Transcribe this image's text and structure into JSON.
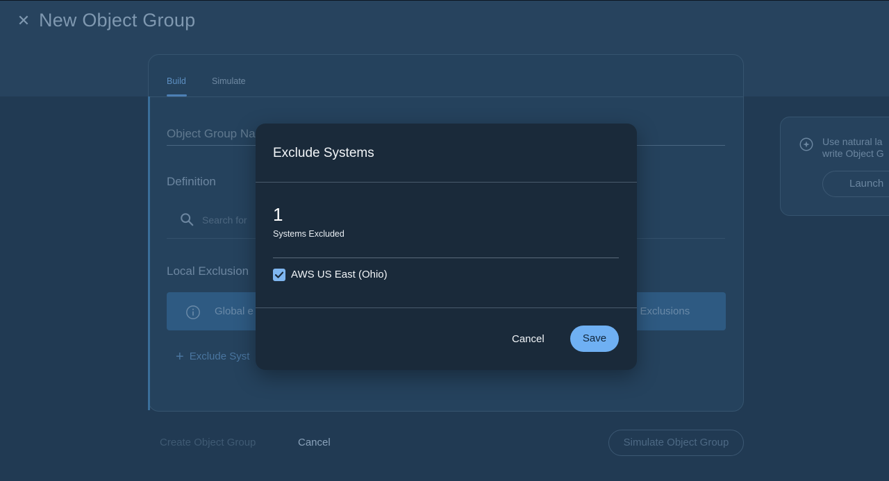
{
  "header": {
    "close_icon": "close-icon",
    "title": "New Object Group"
  },
  "tabs": [
    {
      "label": "Build",
      "active": true
    },
    {
      "label": "Simulate",
      "active": false
    }
  ],
  "form": {
    "name_placeholder": "Object Group Na",
    "definition_heading": "Definition",
    "search_placeholder": "Search for",
    "local_exclusions_heading": "Local Exclusion",
    "info_text": "Global e",
    "info_link": "l Exclusions",
    "exclude_systems_link": "Exclude Syst"
  },
  "footer": {
    "create_label": "Create Object Group",
    "cancel_label": "Cancel",
    "simulate_label": "Simulate Object Group"
  },
  "side_panel": {
    "text_line1": "Use natural la",
    "text_line2": "write Object G",
    "launch_label": "Launch"
  },
  "modal": {
    "title": "Exclude Systems",
    "count": "1",
    "count_label": "Systems Excluded",
    "systems": [
      {
        "label": "AWS US East (Ohio)",
        "checked": true
      }
    ],
    "cancel_label": "Cancel",
    "save_label": "Save"
  },
  "colors": {
    "primary_button": "#6fb0f3",
    "modal_background": "#1a2a3a",
    "page_background": "#213a53"
  }
}
